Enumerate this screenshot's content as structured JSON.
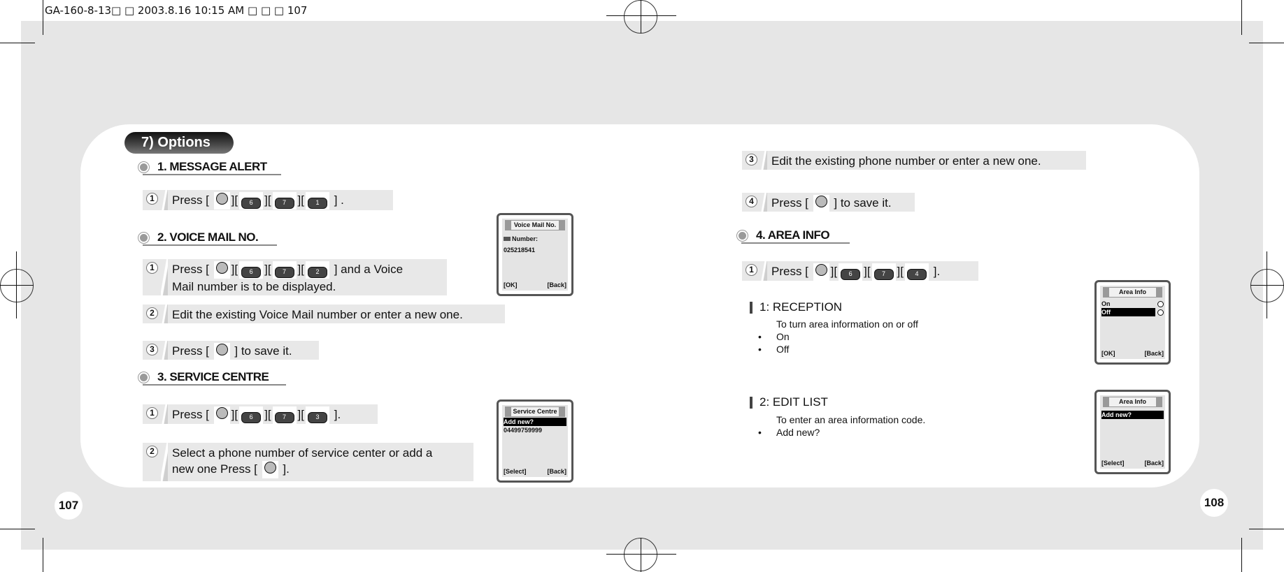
{
  "print_header": "GA-160-8-13□ □   2003.8.16 10:15 AM  □ □ □ 107",
  "page_numbers": {
    "left": "107",
    "right": "108"
  },
  "title": "7) Options",
  "sections": {
    "message_alert": {
      "heading": "1. MESSAGE ALERT",
      "steps": [
        {
          "num": "1",
          "pre": "Press [",
          "keys": [
            "menu",
            "6",
            "7",
            "1"
          ],
          "post": "] ."
        }
      ]
    },
    "voice_mail": {
      "heading": "2. VOICE MAIL NO.",
      "steps": [
        {
          "num": "1",
          "pre": "Press [",
          "keys": [
            "menu",
            "6",
            "7",
            "2"
          ],
          "post": "] and a Voice",
          "line2": "Mail number is to be displayed."
        },
        {
          "num": "2",
          "text": "Edit the existing Voice Mail number or enter a new one."
        },
        {
          "num": "3",
          "pre": "Press [",
          "keys": [
            "menu"
          ],
          "post": "] to save it."
        }
      ],
      "screen": {
        "title": "Voice Mail No.",
        "label": "Number:",
        "value": "025218541",
        "soft_left": "[OK]",
        "soft_right": "[Back]"
      }
    },
    "service_centre": {
      "heading": "3. SERVICE CENTRE",
      "steps": [
        {
          "num": "1",
          "pre": "Press [",
          "keys": [
            "menu",
            "6",
            "7",
            "3"
          ],
          "post": "]."
        },
        {
          "num": "2",
          "text": "Select a phone number of service center or add a",
          "line2_pre": "new one Press [",
          "keys": [
            "menu"
          ],
          "line2_post": "]."
        },
        {
          "num": "3",
          "text": "Edit the existing phone number or enter a new one."
        },
        {
          "num": "4",
          "pre": "Press [",
          "keys": [
            "menu"
          ],
          "post": "] to save it."
        }
      ],
      "screen": {
        "title": "Service Centre",
        "selected": "Add new?",
        "value": "04499759999",
        "soft_left": "[Select]",
        "soft_right": "[Back]"
      }
    },
    "area_info": {
      "heading": "4. AREA INFO",
      "steps": [
        {
          "num": "1",
          "pre": "Press [",
          "keys": [
            "menu",
            "6",
            "7",
            "4"
          ],
          "post": "]."
        }
      ],
      "reception": {
        "heading": "1: RECEPTION",
        "desc": "To turn area information on or off",
        "options": [
          "On",
          "Off"
        ],
        "screen": {
          "title": "Area Info",
          "items": [
            "On",
            "Off"
          ],
          "selected_index": 1,
          "soft_left": "[OK]",
          "soft_right": "[Back]"
        }
      },
      "edit_list": {
        "heading": "2: EDIT LIST",
        "desc": "To enter an area information code.",
        "options": [
          "Add new?"
        ],
        "screen": {
          "title": "Area Info",
          "selected": "Add new?",
          "soft_left": "[Select]",
          "soft_right": "[Back]"
        }
      }
    }
  },
  "key_labels": {
    "menu": "—",
    "6": "6",
    "7": "7",
    "1": "1",
    "2": "2",
    "3": "3",
    "4": "4"
  }
}
